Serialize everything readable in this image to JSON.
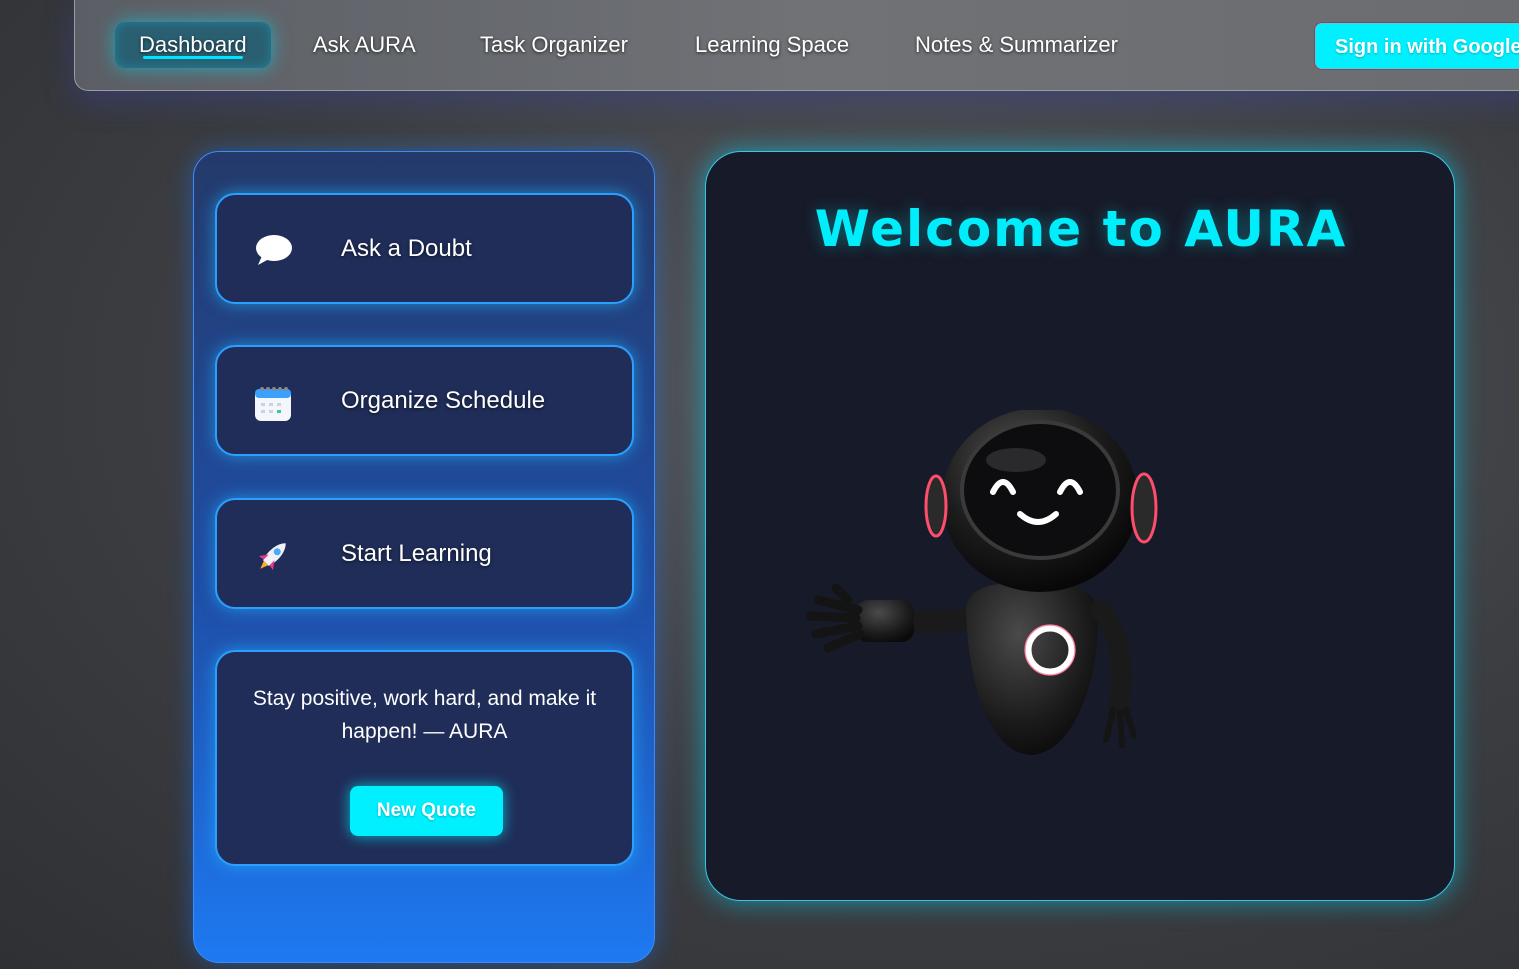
{
  "nav": {
    "items": [
      {
        "label": "Dashboard",
        "active": true
      },
      {
        "label": "Ask AURA",
        "active": false
      },
      {
        "label": "Task Organizer",
        "active": false
      },
      {
        "label": "Learning Space",
        "active": false
      },
      {
        "label": "Notes & Summarizer",
        "active": false
      }
    ],
    "signin_label": "Sign in with Google"
  },
  "sidebar": {
    "actions": [
      {
        "label": "Ask a Doubt",
        "icon": "speech-bubble-icon"
      },
      {
        "label": "Organize Schedule",
        "icon": "calendar-icon"
      },
      {
        "label": "Start Learning",
        "icon": "rocket-icon"
      }
    ],
    "quote": {
      "text": "Stay positive, work hard, and make it happen! — AURA",
      "button_label": "New Quote"
    }
  },
  "main": {
    "title": "Welcome to AURA",
    "robot_icon": "robot-mascot-icon"
  },
  "colors": {
    "accent": "#00eefc",
    "panel_blue": "#1e79f2",
    "card_dark": "#1f2d58",
    "main_bg": "#171a28"
  }
}
